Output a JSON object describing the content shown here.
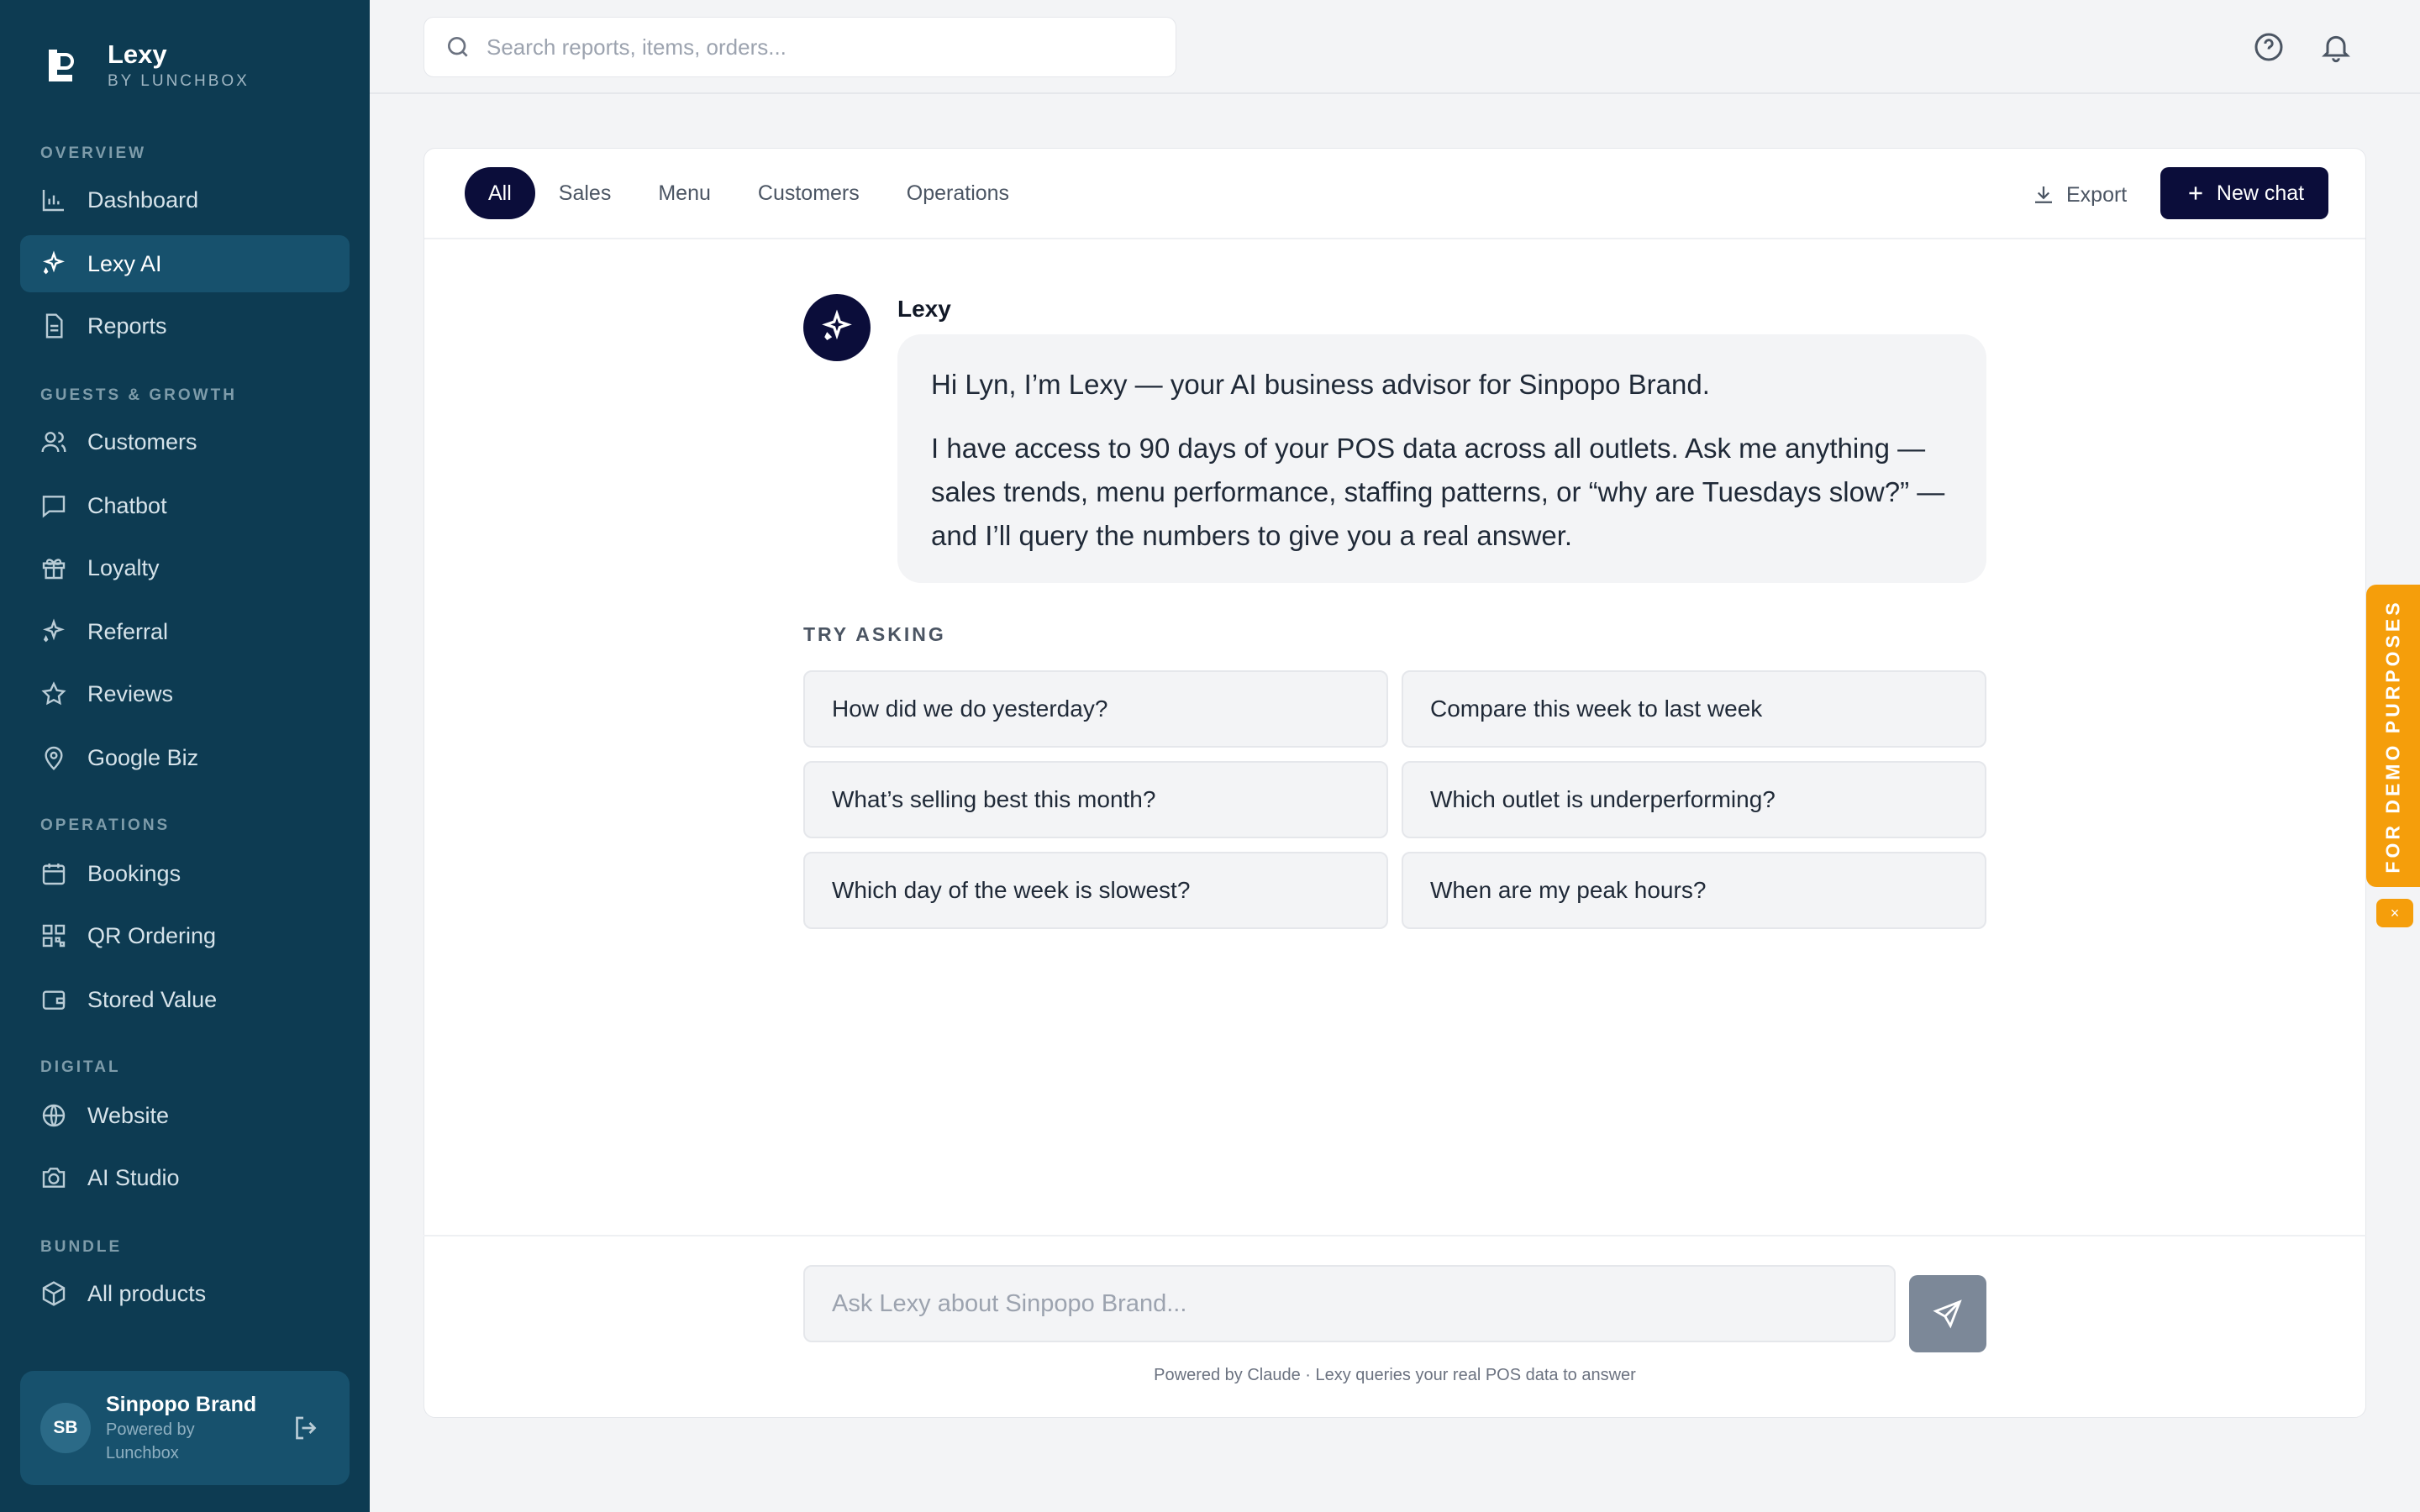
{
  "brand": {
    "name": "Lexy",
    "sub": "BY LUNCHBOX"
  },
  "sidebar": {
    "sections": {
      "overview": "OVERVIEW",
      "guests": "GUESTS & GROWTH",
      "operations": "OPERATIONS",
      "digital": "DIGITAL",
      "bundle": "BUNDLE"
    },
    "items": [
      {
        "label": "Dashboard",
        "icon": "bar-chart-icon"
      },
      {
        "label": "Lexy AI",
        "icon": "sparkle-icon",
        "active": true
      },
      {
        "label": "Reports",
        "icon": "document-icon"
      },
      {
        "label": "Customers",
        "icon": "users-icon"
      },
      {
        "label": "Chatbot",
        "icon": "chat-icon"
      },
      {
        "label": "Loyalty",
        "icon": "gift-icon"
      },
      {
        "label": "Referral",
        "icon": "sparkle-icon"
      },
      {
        "label": "Reviews",
        "icon": "star-icon"
      },
      {
        "label": "Google Biz",
        "icon": "map-pin-icon"
      },
      {
        "label": "Bookings",
        "icon": "calendar-icon"
      },
      {
        "label": "QR Ordering",
        "icon": "qr-code-icon"
      },
      {
        "label": "Stored Value",
        "icon": "wallet-icon"
      },
      {
        "label": "Website",
        "icon": "globe-icon"
      },
      {
        "label": "AI Studio",
        "icon": "camera-icon"
      },
      {
        "label": "All products",
        "icon": "box-icon"
      }
    ]
  },
  "user": {
    "initials": "SB",
    "name": "Sinpopo Brand",
    "sub": "Powered by Lunchbox"
  },
  "topbar": {
    "search_placeholder": "Search reports, items, orders..."
  },
  "tabs": [
    "All",
    "Sales",
    "Menu",
    "Customers",
    "Operations"
  ],
  "actions": {
    "export": "Export",
    "new_chat": "New chat"
  },
  "chat": {
    "bot_name": "Lexy",
    "message_1": "Hi Lyn, I’m Lexy — your AI business advisor for Sinpopo Brand.",
    "message_2": "I have access to 90 days of your POS data across all outlets. Ask me anything — sales trends, menu performance, staffing patterns, or “why are Tuesdays slow?” — and I’ll query the numbers to give you a real answer."
  },
  "try_asking": {
    "label": "TRY ASKING",
    "suggestions": [
      "How did we do yesterday?",
      "Compare this week to last week",
      "What’s selling best this month?",
      "Which outlet is underperforming?",
      "Which day of the week is slowest?",
      "When are my peak hours?"
    ]
  },
  "composer": {
    "placeholder": "Ask Lexy about Sinpopo Brand...",
    "footer": "Powered by Claude · Lexy queries your real POS data to answer"
  },
  "demo": {
    "label": "FOR DEMO PURPOSES",
    "close": "×"
  },
  "colors": {
    "sidebar": "#0d3b52",
    "accent": "#0b0d3a",
    "demo": "#f59e0b"
  }
}
